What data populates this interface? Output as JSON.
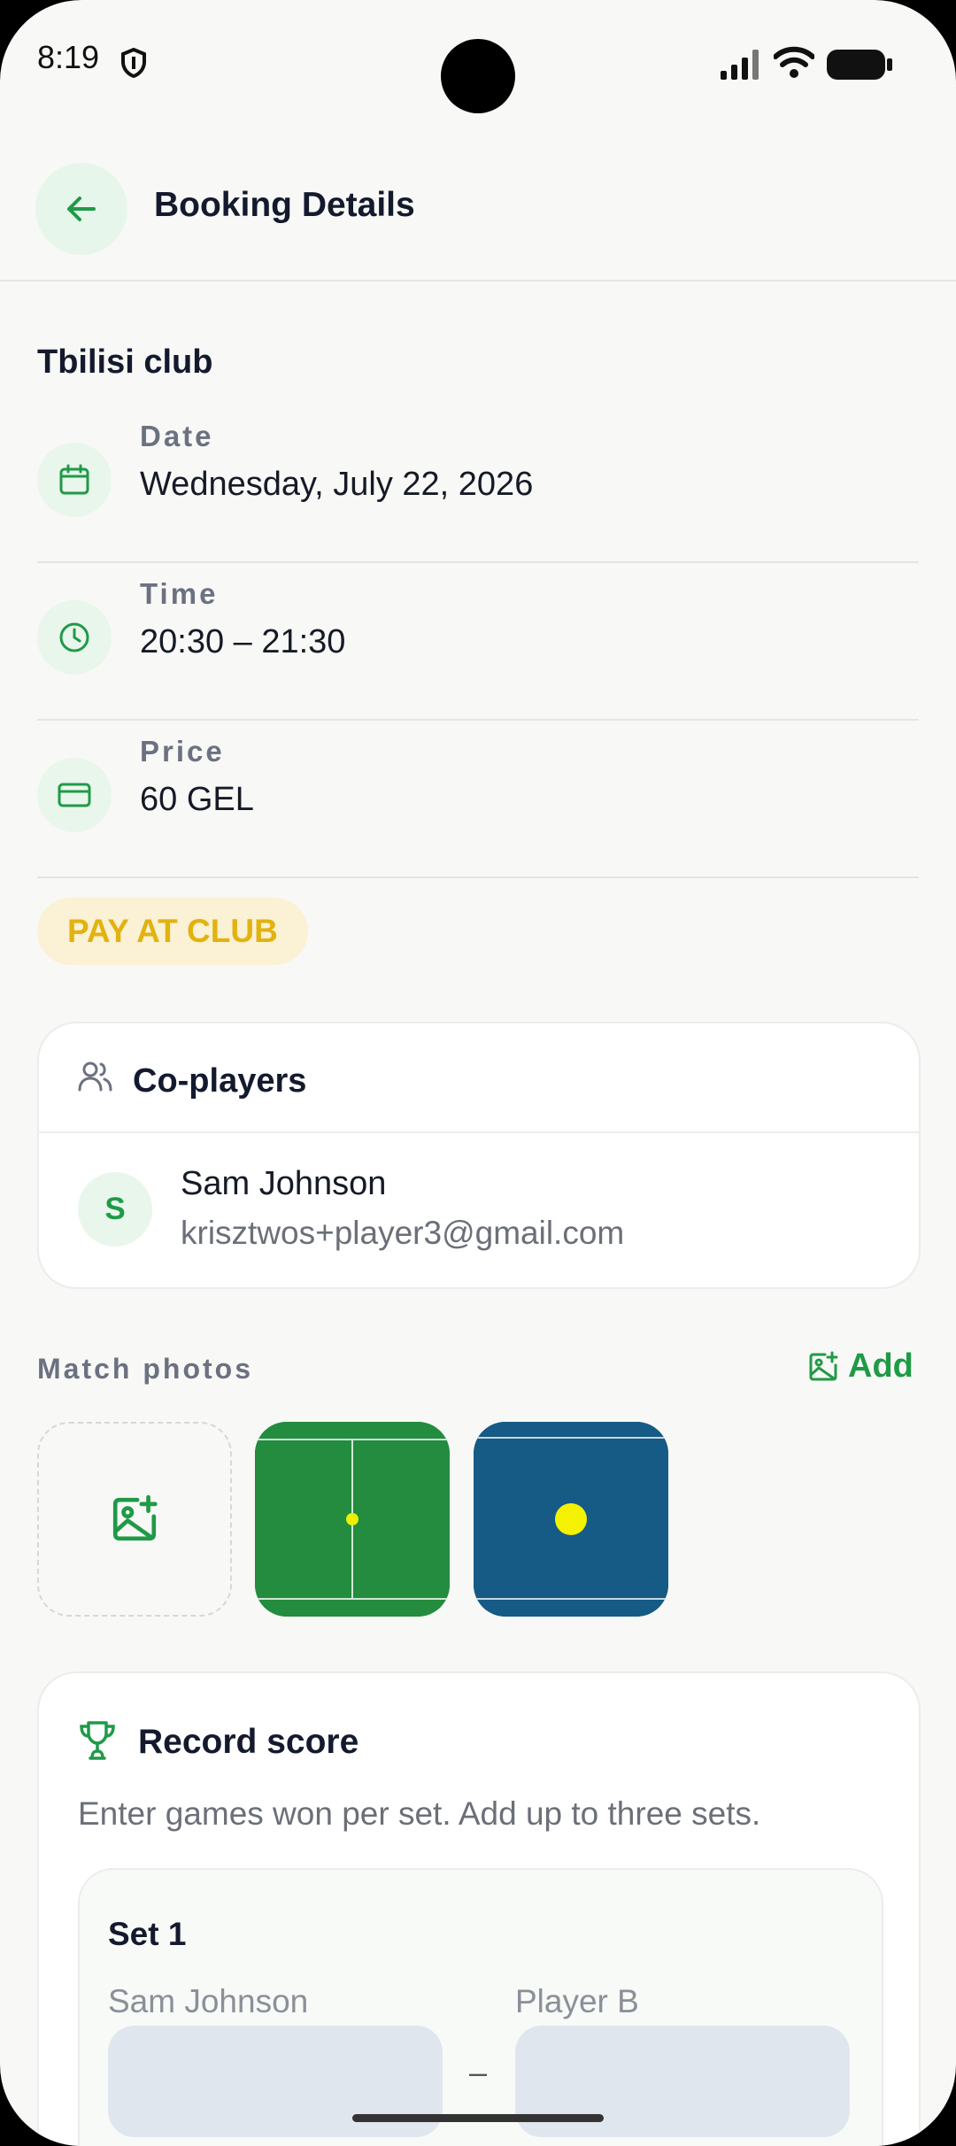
{
  "status_bar": {
    "time": "8:19"
  },
  "header": {
    "title": "Booking Details"
  },
  "booking": {
    "club": "Tbilisi club",
    "date_label": "Date",
    "date_value": "Wednesday, July 22, 2026",
    "time_label": "Time",
    "time_value": "20:30 – 21:30",
    "price_label": "Price",
    "price_value": "60 GEL",
    "payment_badge": "PAY AT CLUB"
  },
  "coplayers": {
    "title": "Co-players",
    "players": [
      {
        "initial": "S",
        "name": "Sam Johnson",
        "email": "krisztwos+player3@gmail.com"
      }
    ]
  },
  "photos": {
    "title": "Match photos",
    "add_label": "Add"
  },
  "score": {
    "title": "Record score",
    "description": "Enter games won per set. Add up to three sets.",
    "set_title": "Set 1",
    "player_a": "Sam Johnson",
    "player_b": "Player B",
    "separator": "–"
  },
  "colors": {
    "accent": "#1f9a47",
    "badge_text": "#e2b20f",
    "badge_bg": "#fbf1d4"
  }
}
